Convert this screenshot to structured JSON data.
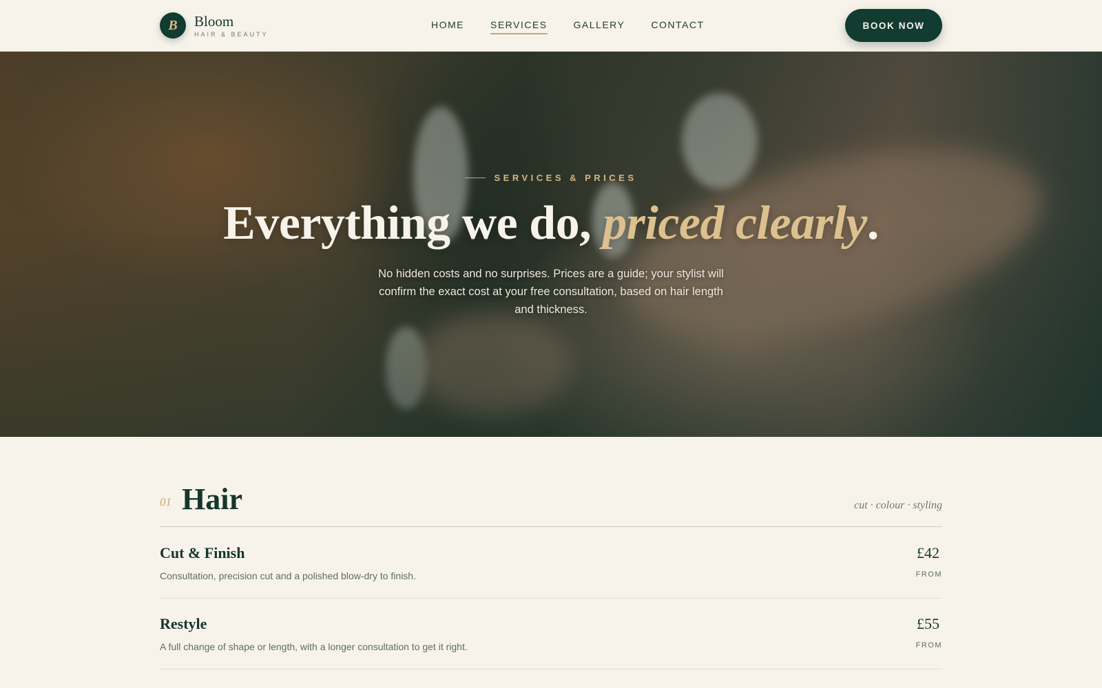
{
  "brand": {
    "initial": "B",
    "name": "Bloom",
    "tagline": "HAIR & BEAUTY"
  },
  "nav": {
    "items": [
      {
        "label": "HOME",
        "active": false
      },
      {
        "label": "SERVICES",
        "active": true
      },
      {
        "label": "GALLERY",
        "active": false
      },
      {
        "label": "CONTACT",
        "active": false
      }
    ],
    "cta_label": "BOOK NOW"
  },
  "hero": {
    "eyebrow": "SERVICES & PRICES",
    "title_main": "Everything we do, ",
    "title_accent": "priced clearly",
    "title_end": ".",
    "subtitle": "No hidden costs and no surprises. Prices are a guide; your stylist will confirm the exact cost at your free consultation, based on hair length and thickness."
  },
  "section": {
    "number": "01",
    "title": "Hair",
    "meta": "cut · colour · styling",
    "services": [
      {
        "name": "Cut & Finish",
        "description": "Consultation, precision cut and a polished blow-dry to finish.",
        "price": "£42",
        "price_note": "FROM"
      },
      {
        "name": "Restyle",
        "description": "A full change of shape or length, with a longer consultation to get it right.",
        "price": "£55",
        "price_note": "FROM"
      }
    ]
  },
  "colors": {
    "primary": "#123b31",
    "accent": "#c9a66b",
    "background": "#f7f3ea"
  }
}
